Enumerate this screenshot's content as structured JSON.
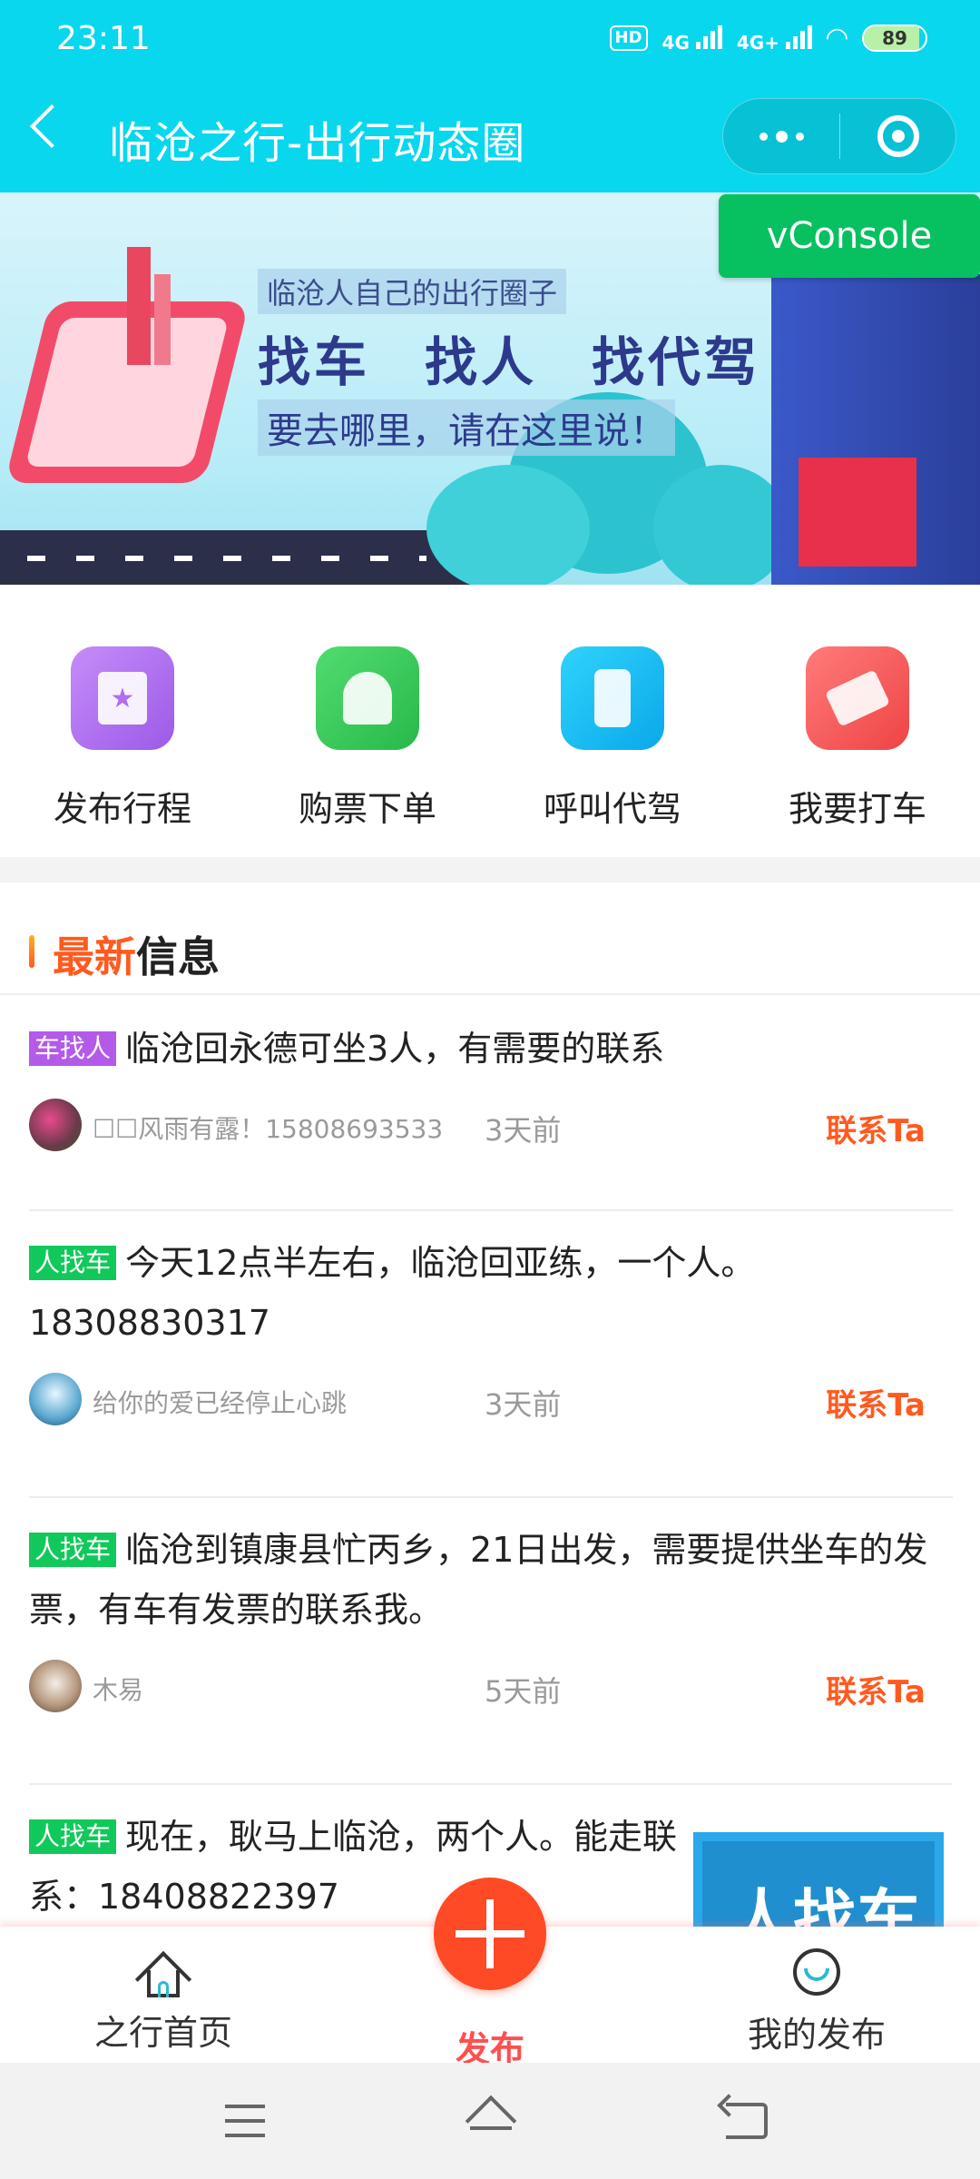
{
  "status_bar": {
    "time": "23:11",
    "hd_label": "HD",
    "net1": "4G",
    "net2": "4G+",
    "battery": "89",
    "battery_level": 0.89
  },
  "header": {
    "title": "临沧之行-出行动态圈",
    "back_icon": "chevron-left-icon",
    "more_icon": "more-dots-icon",
    "close_icon": "target-close-icon"
  },
  "vconsole_label": "vConsole",
  "banner": {
    "subtitle": "临沧人自己的出行圈子",
    "main": [
      "找车",
      "找人",
      "找代驾"
    ],
    "tagline": "要去哪里，请在这里说！"
  },
  "quick_actions": [
    {
      "label": "发布行程",
      "icon": "star-card-icon",
      "color": "#b06ef0"
    },
    {
      "label": "购票下单",
      "icon": "user-ticket-icon",
      "color": "#36c85a"
    },
    {
      "label": "呼叫代驾",
      "icon": "phone-car-icon",
      "color": "#10b8f0"
    },
    {
      "label": "我要打车",
      "icon": "ticket-icon",
      "color": "#f25858"
    }
  ],
  "section": {
    "title_highlight": "最新",
    "title_rest": "信息"
  },
  "posts": [
    {
      "tag": "车找人",
      "text": "临沧回永德可坐3人，有需要的联系",
      "user": "☐☐风雨有露！15808693533",
      "time": "3天前",
      "contact": "联系Ta"
    },
    {
      "tag": "人找车",
      "text": "今天12点半左右，临沧回亚练，一个人。18308830317",
      "user": "给你的爱已经停止心跳",
      "time": "3天前",
      "contact": "联系Ta"
    },
    {
      "tag": "人找车",
      "text": "临沧到镇康县忙丙乡，21日出发，需要提供坐车的发票，有车有发票的联系我。",
      "user": "木易",
      "time": "5天前",
      "contact": "联系Ta"
    },
    {
      "tag": "人找车",
      "text": "现在，耿马上临沧，两个人。能走联系：18408822397",
      "thumb_text": "人找车"
    }
  ],
  "tabbar": {
    "home": "之行首页",
    "publish": "发布",
    "mine": "我的发布"
  }
}
